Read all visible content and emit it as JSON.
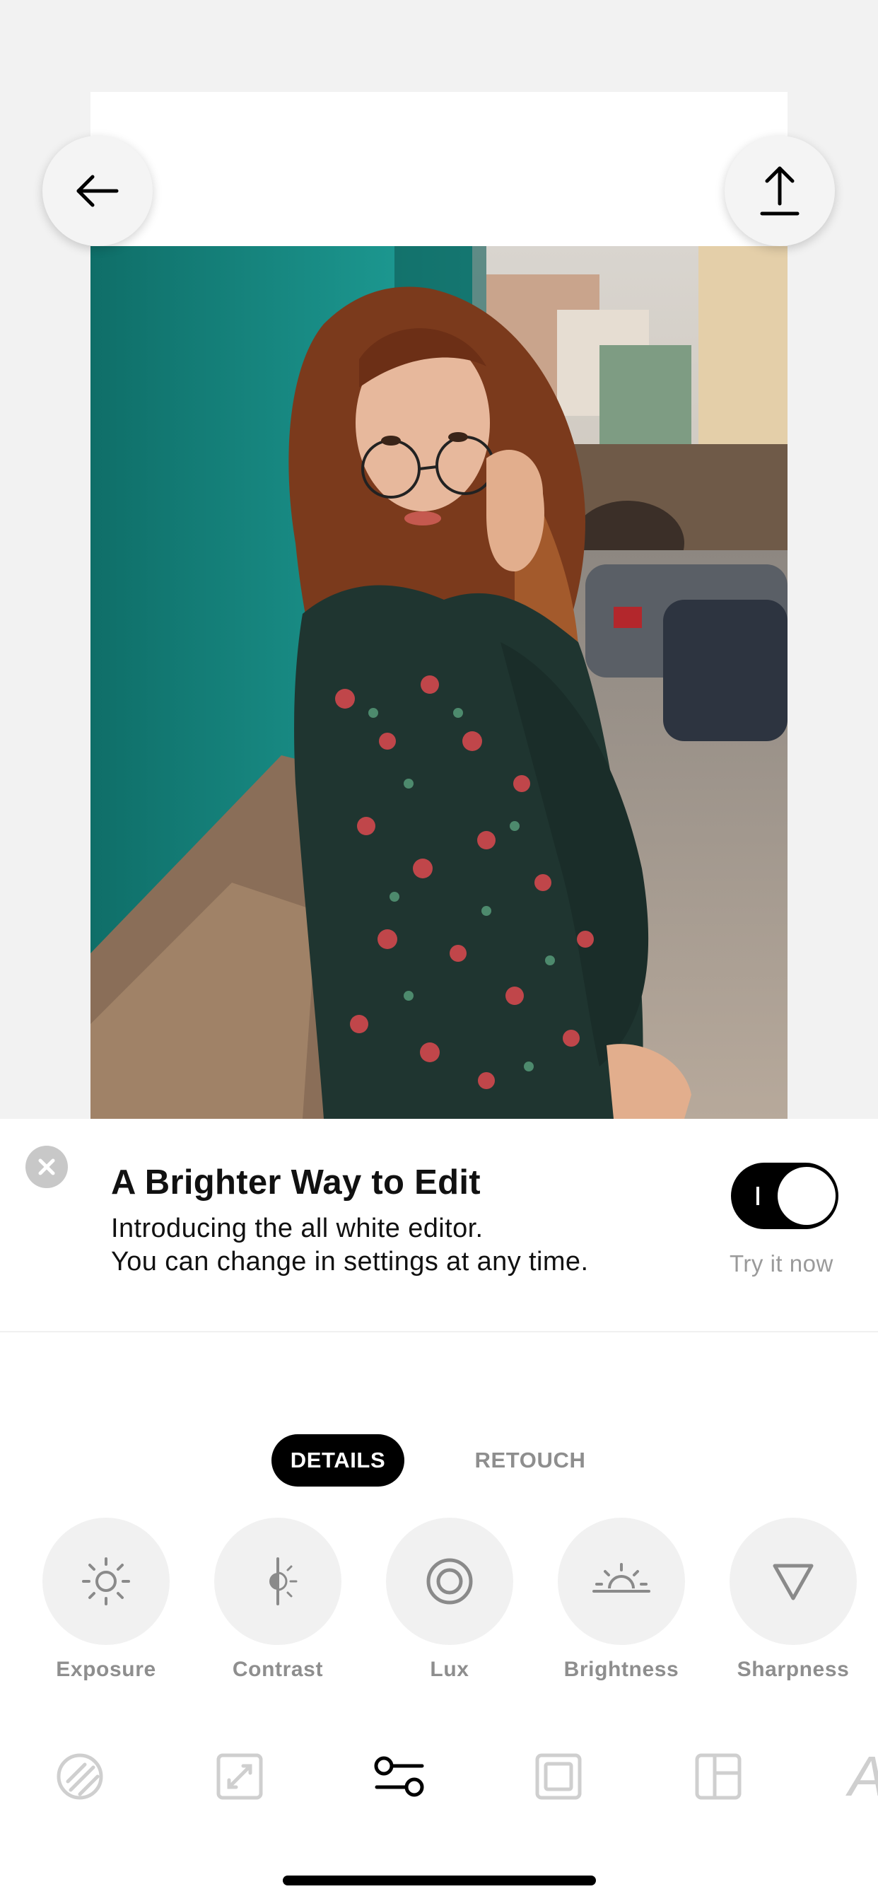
{
  "top_bar": {
    "back_icon": "arrow-left-icon",
    "share_icon": "share-upload-icon"
  },
  "banner": {
    "title": "A Brighter Way to Edit",
    "line1": "Introducing the all white editor.",
    "line2": "You can change in settings at any time.",
    "toggle_caption": "Try it now",
    "toggle_on": true,
    "close_icon": "close-icon"
  },
  "tabs": [
    {
      "label": "DETAILS",
      "active": true
    },
    {
      "label": "RETOUCH",
      "active": false
    }
  ],
  "tools": [
    {
      "label": "Exposure",
      "icon": "sun-icon"
    },
    {
      "label": "Contrast",
      "icon": "contrast-icon"
    },
    {
      "label": "Lux",
      "icon": "lux-rings-icon"
    },
    {
      "label": "Brightness",
      "icon": "sunrise-icon"
    },
    {
      "label": "Sharpness",
      "icon": "triangle-down-icon"
    }
  ],
  "bottom_nav": [
    {
      "icon": "filters-icon",
      "active": false
    },
    {
      "icon": "crop-expand-icon",
      "active": false
    },
    {
      "icon": "adjust-sliders-icon",
      "active": true
    },
    {
      "icon": "frame-icon",
      "active": false
    },
    {
      "icon": "layout-icon",
      "active": false
    },
    {
      "icon": "text-icon",
      "active": false
    }
  ],
  "colors": {
    "background": "#f2f2f2",
    "accent": "#000000",
    "muted_text": "#8e8e8e",
    "inactive_icon": "#cfcfcf"
  }
}
